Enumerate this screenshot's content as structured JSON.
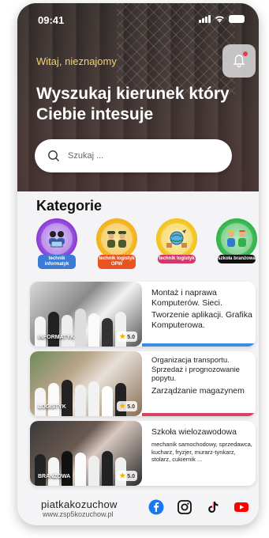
{
  "status": {
    "time": "09:41"
  },
  "hero": {
    "greeting": "Witaj, nieznajomy",
    "headline": "Wyszukaj kierunek który Ciebie intesuje",
    "search_placeholder": "Szukaj ..."
  },
  "categories": {
    "title": "Kategorie",
    "items": [
      {
        "label": "technik informatyk",
        "color": "#3a7bd5",
        "ring": "#8a3bd5",
        "icon": "people-laptop-icon"
      },
      {
        "label": "technik logistyk OPW",
        "color": "#e8531f",
        "ring": "#f2b21a",
        "icon": "soldiers-icon"
      },
      {
        "label": "technik logistyk",
        "color": "#d33868",
        "ring": "#f2c21a",
        "icon": "globe-logistics-icon"
      },
      {
        "label": "szkoła branżowa",
        "color": "#111111",
        "ring": "#2fb24a",
        "icon": "workers-icon"
      }
    ]
  },
  "cards": [
    {
      "photo_label": "INFORMATYK",
      "rating": "5.0",
      "title": "Montaż i naprawa Komputerów. Sieci.",
      "subtitle": "Tworzenie aplikacji. Grafika Komputerowa.",
      "accent": "#3a8ee6"
    },
    {
      "photo_label": "LOGISTYK",
      "rating": "5.0",
      "title": "Organizacja transportu. Sprzedaż i prognozowanie popytu.",
      "subtitle": "Zarządzanie magazynem",
      "accent": "#d6455f"
    },
    {
      "photo_label": "BRANŻOWA",
      "rating": "5.0",
      "title": "Szkoła wielozawodowa",
      "subtitle": "mechanik samochodowy, sprzedawca, kucharz, fryzjer, murarz-tynkarz, stolarz, cukiernik ...",
      "accent": ""
    }
  ],
  "footer": {
    "brand": "piatkakozuchow",
    "url": "www.zsp5kozuchow.pl",
    "socials": [
      "facebook-icon",
      "instagram-icon",
      "tiktok-icon",
      "youtube-icon"
    ]
  }
}
